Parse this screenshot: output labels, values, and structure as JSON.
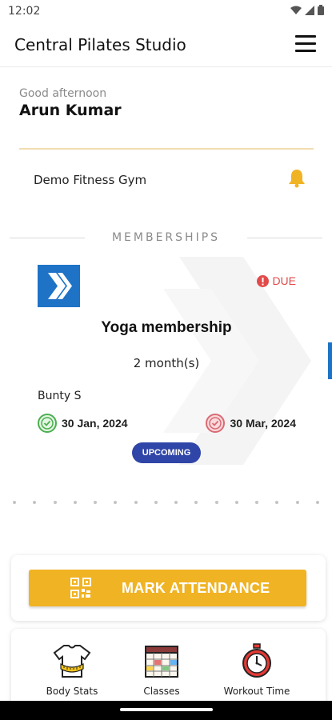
{
  "status_bar": {
    "time": "12:02"
  },
  "app_bar": {
    "title": "Central Pilates Studio"
  },
  "greeting": {
    "salutation": "Good afternoon",
    "name": "Arun Kumar"
  },
  "gym": {
    "name": "Demo Fitness Gym"
  },
  "memberships": {
    "section_title": "MEMBERSHIPS",
    "card": {
      "due_label": "DUE",
      "plan_name": "Yoga membership",
      "duration": "2 month(s)",
      "trainer": "Bunty S",
      "start_date": "30 Jan, 2024",
      "end_date": "30 Mar, 2024",
      "status_badge": "UPCOMING"
    }
  },
  "attendance": {
    "button_label": "MARK ATTENDANCE"
  },
  "quick_actions": [
    {
      "label": "Body Stats",
      "icon": "tshirt-measure-icon"
    },
    {
      "label": "Classes",
      "icon": "calendar-schedule-icon"
    },
    {
      "label": "Workout Time",
      "icon": "stopwatch-icon"
    }
  ],
  "colors": {
    "accent": "#f0b323",
    "due_red": "#e24a4a",
    "badge_blue": "#2f45a7",
    "logo_blue": "#1e73c6"
  }
}
